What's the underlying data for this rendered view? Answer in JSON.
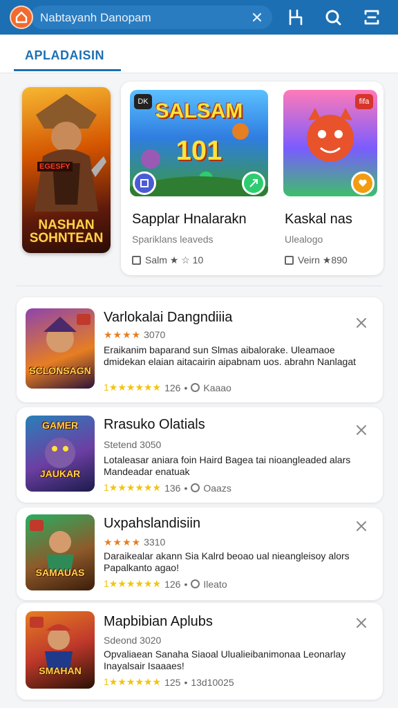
{
  "header": {
    "search_text": "Nabtayanh Danopam",
    "colors": {
      "bar": "#1c6fb3",
      "logo": "#f26a2e"
    },
    "icons": [
      "home-icon",
      "clear-icon",
      "filter-icon",
      "search-icon",
      "expand-icon"
    ]
  },
  "tabs": [
    {
      "label": "APLADAISIN",
      "active": true
    }
  ],
  "featured": {
    "poster": {
      "title": "NASHAN SOHNTEAN",
      "badge": "EGESFY"
    },
    "cards": [
      {
        "art_title": "SALSAM",
        "art_number": "101",
        "chip": "DK",
        "name": "Sapplar Hnalarakn",
        "developer": "Spariklans leaveds",
        "meta": "Salm ★ ☆ 10"
      },
      {
        "chip": "fifa",
        "name": "Kaskal nas",
        "developer": "Ulealogo",
        "meta": "Veirn ★890"
      }
    ]
  },
  "list": [
    {
      "title": "Varlokalai Dangndiiia",
      "stars": "★★★★",
      "sub_text": "3070",
      "desc": "Eraikanim baparand sun Slmas aibalorake. Uleamaoe dmidekan elaian aitacairin aipabnam uos. abrahn Nanlagat",
      "foot_stars": "1★★★★★★",
      "foot_count": "126",
      "foot_time": "Kaaao",
      "thumb_title": "SCLONSAGN"
    },
    {
      "title": "Rrasuko Olatials",
      "stars": "",
      "sub_text": "Stetend 3050",
      "desc": "Lotaleasar aniara foin Haird Bagea tai nioangleaded alars Mandeadar enatuak",
      "foot_stars": "1★★★★★★",
      "foot_count": "136",
      "foot_time": "Oaazs",
      "thumb_title": "JAUKAR"
    },
    {
      "title": "Uxpahslandisiin",
      "stars": "★★★★",
      "sub_text": "3310",
      "desc": "Daraikealar akann Sia Kalrd beoao ual nieangleisoy alors Papalkanto agao!",
      "foot_stars": "1★★★★★★",
      "foot_count": "126",
      "foot_time": "Ileato",
      "thumb_title": "SAMAUAS"
    },
    {
      "title": "Mapbibian Aplubs",
      "stars": "",
      "sub_text": "Sdeond 3020",
      "desc": "Opvaliaean Sanaha Siaoal Ulualieibanimonaa Leonarlay Inayalsair Isaaaes!",
      "foot_stars": "1★★★★★★",
      "foot_count": "125",
      "foot_time": "13d10025",
      "thumb_title": "SMAHAN"
    }
  ]
}
